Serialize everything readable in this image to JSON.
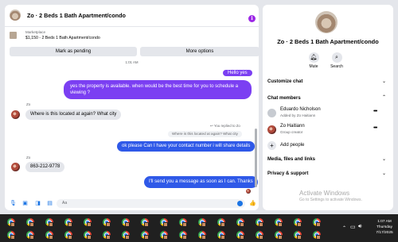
{
  "chat": {
    "title": "Zo · 2 Beds 1 Bath Apartment/condo",
    "marketplace_label": "Marketplace",
    "listing": "$1,150 - 2 Beds 1 Bath Apartment/condo",
    "mark_pending": "Mark as pending",
    "more_options": "More options",
    "timestamp": "1:01 AM",
    "messages": {
      "hello": "Hello yes",
      "available": "yes the property is available. when would be the best time for you to schedule a viewing ?",
      "sender1": "Zo",
      "where": "Where is this located at again? What city",
      "replied_to": "You replied to Zo",
      "quote": "Where is this located at again? What city",
      "ok": "ok  please Can I have your contact number i will share details",
      "sender2": "Zo",
      "phone": "863-212-9778",
      "send": "I'll send you a message as soon as I can. Thanks"
    },
    "composer_placeholder": "Aa"
  },
  "details": {
    "title": "Zo · 2 Beds 1 Bath Apartment/condo",
    "mute_label": "Mute",
    "search_label": "Search",
    "customize": "Customize chat",
    "members_header": "Chat members",
    "members": [
      {
        "name": "Eduardo Nicholson",
        "sub": "Added by Zo Haitiann"
      },
      {
        "name": "Zo Haitiann",
        "sub": "Group creator"
      }
    ],
    "add_people": "Add people",
    "media": "Media, files and links",
    "privacy": "Privacy & support"
  },
  "watermark": {
    "title": "Activate Windows",
    "sub": "Go to Settings to activate Windows."
  },
  "taskbar": {
    "time": "1:07 AM",
    "day": "Thursday",
    "date": "7/17/2025"
  }
}
